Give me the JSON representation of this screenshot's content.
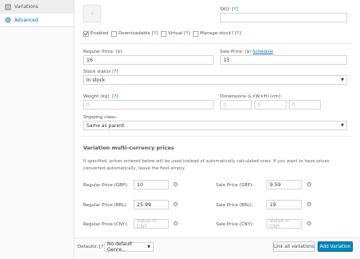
{
  "sidebar": {
    "items": [
      {
        "label": "Variations",
        "icon": "variations-icon"
      },
      {
        "label": "Advanced",
        "icon": "gear-icon"
      }
    ]
  },
  "thumb": {
    "placeholder_symbol": "+"
  },
  "sku": {
    "label": "SKU:",
    "help": "[?]",
    "value": ""
  },
  "options": {
    "enabled": {
      "label": "Enabled",
      "checked": true
    },
    "downloadable": {
      "label": "Downloadable",
      "help": "[?]",
      "checked": false
    },
    "virtual": {
      "label": "Virtual",
      "help": "[?]",
      "checked": false
    },
    "manage_stock": {
      "label": "Manage stock?",
      "help": "[?]",
      "checked": false
    }
  },
  "regular_price": {
    "label": "Regular Price: ($)",
    "value": "16"
  },
  "sale_price": {
    "label": "Sale Price: ($)",
    "link": "Schedule",
    "value": "15"
  },
  "stock_status": {
    "label": "Stock status",
    "help": "[?]",
    "value": "In stock"
  },
  "weight": {
    "label": "Weight (kg):",
    "help": "[?]",
    "placeholder": "0"
  },
  "dimensions": {
    "label": "Dimensions (L×W×H) (cm):",
    "placeholders": [
      "0",
      "0",
      "0"
    ]
  },
  "shipping_class": {
    "label": "Shipping class:",
    "value": "Same as parent"
  },
  "multicurrency": {
    "heading": "Variation multi-currency prices",
    "description": "If specified, prices entered below will be used instead of automatically calculated ones. If you want to have prices converted automatically, leave the field empty.",
    "rows": [
      {
        "regular_label": "Regular Price (GBP):",
        "regular_value": "10",
        "regular_placeholder": "",
        "sale_label": "Sale Price (GBP):",
        "sale_value": "9.59",
        "sale_placeholder": ""
      },
      {
        "regular_label": "Regular Price (BRL):",
        "regular_value": "25.99",
        "regular_placeholder": "",
        "sale_label": "Sale Price (BRL):",
        "sale_value": "19",
        "sale_placeholder": ""
      },
      {
        "regular_label": "Regular Price (CNY):",
        "regular_value": "",
        "regular_placeholder": "Value in CNY",
        "sale_label": "Sale Price (CNY):",
        "sale_value": "",
        "sale_placeholder": "Value in CNY"
      }
    ]
  },
  "footer": {
    "defaults_label": "Defaults: [?]",
    "defaults_select": "No default Genre…",
    "link_all_button": "Link all variations",
    "add_variation_button": "Add Variation"
  },
  "colors": {
    "accent": "#0073aa",
    "primary_button": "#0085ba"
  }
}
